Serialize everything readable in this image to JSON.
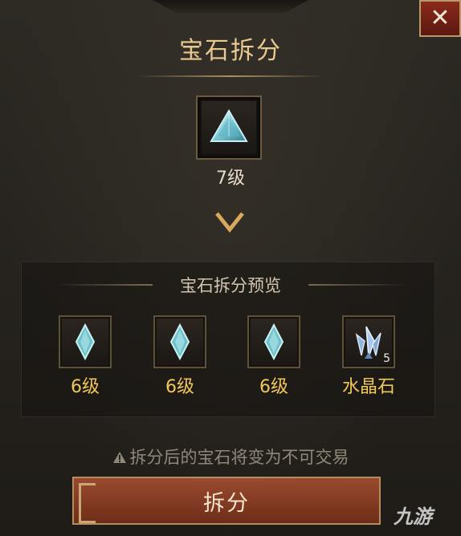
{
  "dialog": {
    "title": "宝石拆分",
    "close_icon": "close-icon"
  },
  "source": {
    "icon": "triangle-gem-icon",
    "level": "7级"
  },
  "preview": {
    "title": "宝石拆分预览",
    "items": [
      {
        "icon": "gem-icon",
        "label": "6级",
        "count": ""
      },
      {
        "icon": "gem-icon",
        "label": "6级",
        "count": ""
      },
      {
        "icon": "gem-icon",
        "label": "6级",
        "count": ""
      },
      {
        "icon": "crystal-icon",
        "label": "水晶石",
        "count": "5"
      }
    ]
  },
  "warning": "拆分后的宝石将变为不可交易",
  "confirm_button": "拆分",
  "watermark": "九游",
  "colors": {
    "title": "#e8c98f",
    "level_gold": "#f0c75a",
    "button": "#8a3f26"
  }
}
